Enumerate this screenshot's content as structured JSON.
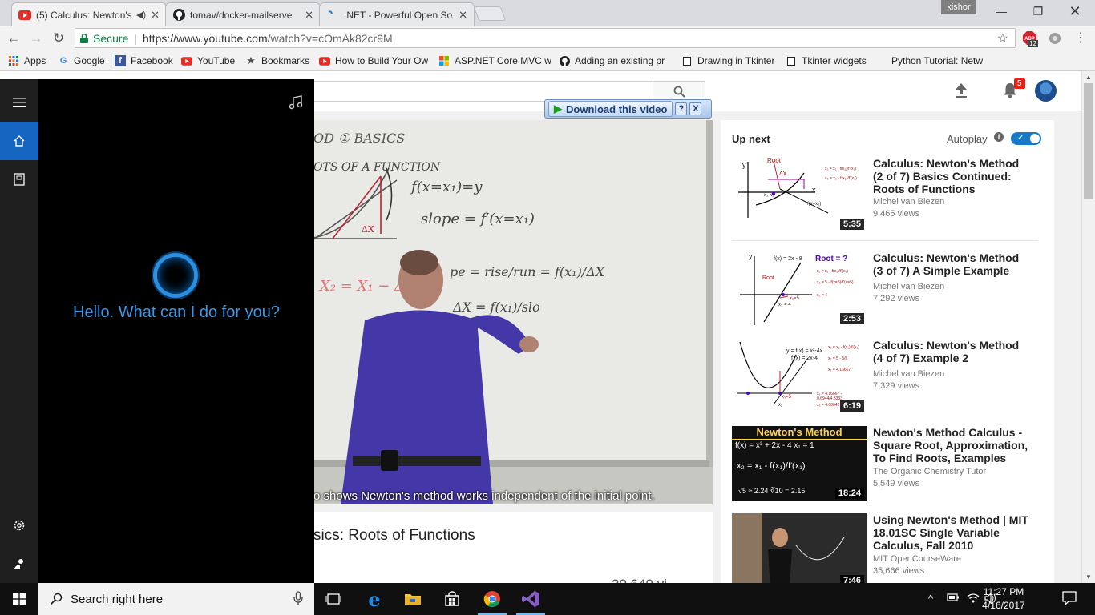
{
  "browser": {
    "tabs": [
      {
        "title": "(5) Calculus: Newton's",
        "icon": "youtube-icon",
        "audio": true,
        "active": true
      },
      {
        "title": "tomav/docker-mailserve",
        "icon": "github-icon",
        "active": false
      },
      {
        "title": ".NET - Powerful Open So",
        "icon": "dotnet-icon",
        "active": false
      }
    ],
    "profile_name": "kishor",
    "secure_label": "Secure",
    "url_base": "https://www.youtube.com",
    "url_path": "/watch?v=cOmAk82cr9M",
    "extension_badge": "12",
    "bookmarks": [
      {
        "label": "Apps",
        "icon": "apps-grid-icon"
      },
      {
        "label": "Google",
        "icon": "google-icon"
      },
      {
        "label": "Facebook",
        "icon": "facebook-icon"
      },
      {
        "label": "YouTube",
        "icon": "youtube-icon"
      },
      {
        "label": "Bookmarks",
        "icon": "star-icon"
      },
      {
        "label": "How to Build Your Ow",
        "icon": "youtube-icon"
      },
      {
        "label": "ASP.NET Core MVC w",
        "icon": "microsoft-icon"
      },
      {
        "label": "Adding an existing pr",
        "icon": "github-icon"
      },
      {
        "label": "Drawing in Tkinter",
        "icon": "page-icon"
      },
      {
        "label": "Tkinter widgets",
        "icon": "page-icon"
      },
      {
        "label": "Python Tutorial: Netw",
        "icon": "none"
      }
    ]
  },
  "youtube": {
    "notification_count": "5",
    "download_label": "Download this video",
    "download_help": "?",
    "download_close": "X",
    "caption": "o shows Newton's method works independent of the initial point.",
    "video_title": "sics: Roots of Functions",
    "view_count": "20,640 vi",
    "whiteboard": {
      "heading1": "OD ① BASICS",
      "heading2": "OTS OF A FUNCTION",
      "eq1": "f(x=x₁)=y",
      "eq2": "slope = f′(x=x₁)",
      "eq3": "pe = rise/run = f(x₁)/ΔX",
      "eq4": "ΔX = f(x₁)/slo",
      "eq5": "X₂ = X₁ − ΔX",
      "dx": "ΔX"
    },
    "upnext": {
      "title": "Up next",
      "autoplay_label": "Autoplay",
      "autoplay_on": true,
      "items": [
        {
          "title": "Calculus: Newton's Method (2 of 7) Basics Continued: Roots of Functions",
          "channel": "Michel van Biezen",
          "views": "9,465 views",
          "duration": "5:35"
        },
        {
          "title": "Calculus: Newton's Method (3 of 7) A Simple Example",
          "channel": "Michel van Biezen",
          "views": "7,292 views",
          "duration": "2:53"
        },
        {
          "title": "Calculus: Newton's Method (4 of 7) Example 2",
          "channel": "Michel van Biezen",
          "views": "7,329 views",
          "duration": "6:19"
        },
        {
          "title": "Newton's Method Calculus - Square Root, Approximation, To Find Roots, Examples",
          "channel": "The Organic Chemistry Tutor",
          "views": "5,549 views",
          "duration": "18:24"
        },
        {
          "title": "Using Newton's Method | MIT 18.01SC Single Variable Calculus, Fall 2010",
          "channel": "MIT OpenCourseWare",
          "views": "35,666 views",
          "duration": "7:46"
        }
      ],
      "thumb_text": {
        "t1": {
          "root": "Root",
          "dx": "ΔX",
          "y": "y",
          "x": "x",
          "fx": "f(x=x₁)",
          "f1": "x₂ = x₁ - f(x₁)/f′(x₁)",
          "f2": "x₃ = x₂ - f(x₂)/f′(x₂)",
          "labels": "x₃ x₂"
        },
        "t2": {
          "fx": "f(x) = 2x - 8",
          "root": "Root = ?",
          "rootlbl": "Root",
          "y": "y",
          "x3": "x₃ = 4",
          "x1": "x₁=5",
          "f1": "x₂ = x₁ - f(x₁)/f′(x₁)",
          "f2": "x₂ = 5 - f(x=5)/f′(x=5)",
          "f3": "x₂ = 4"
        },
        "t3": {
          "eq1": "y = f(x) = x²-4x",
          "eq2": "f′(x) = 2x-4",
          "v1": "x₂ = 4.16667",
          "v2": "x₃ = 4.16667 - 0.6944/4.3333",
          "v3": "x₃ = 4.00642",
          "x1": "x₁=5",
          "lbl": "x₂",
          "f1": "x₂ = x₁ - f(x₁)/f′(x₁)",
          "f2": "x₂ = 5 - 5/6"
        },
        "t4": {
          "header": "Newton's Method",
          "l1": "f(x) = x³ + 2x - 4    x₁ = 1",
          "l2": "x₂ = x₁ - f(x₁)/f′(x₁)",
          "l3": "√5 ≈ 2.24    ∛10 = 2.15"
        }
      }
    }
  },
  "cortana": {
    "greeting": "Hello. What can I do for you?"
  },
  "taskbar": {
    "search_placeholder": "Search right here",
    "time": "11:27 PM",
    "date": "4/16/2017"
  }
}
